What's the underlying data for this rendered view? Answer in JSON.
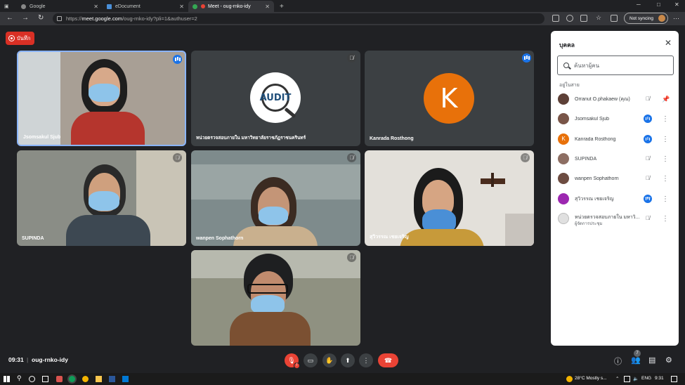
{
  "browser": {
    "tabs": [
      {
        "label": "Google",
        "favicon": "google-icon",
        "active": false
      },
      {
        "label": "eDocument",
        "favicon": "document-icon",
        "active": false
      },
      {
        "label": "Meet - oug-rnko-idy",
        "favicon": "meet-icon",
        "active": true
      }
    ],
    "new_tab": "+",
    "window_controls": {
      "minimize": "─",
      "maximize": "□",
      "close": "✕"
    },
    "url_prefix": "https://",
    "url_domain": "meet.google.com",
    "url_path": "/oug-rnko-idy?pli=1&authuser=2",
    "sync_label": "Not syncing"
  },
  "meet": {
    "record_label": "บันทึก",
    "tiles": [
      {
        "name": "Jsomsakul Sjub",
        "status": "speaking"
      },
      {
        "name": "หน่วยตรวจสอบภายใน มหาวิทยาลัยราชภัฏราชนครินทร์",
        "status": "muted",
        "logo_text": "AUDIT"
      },
      {
        "name": "Kanrada Rosthong",
        "status": "speaking",
        "avatar_letter": "K"
      },
      {
        "name": "SUPINDA",
        "status": "muted"
      },
      {
        "name": "wanpen Sophathorn",
        "status": "muted"
      },
      {
        "name": "สุวิวรรณ เชยเจริญ",
        "status": "muted"
      },
      {
        "name": "",
        "status": "muted"
      }
    ],
    "time": "09:31",
    "separator": "|",
    "meeting_code": "oug-rnko-idy",
    "participant_count": "7",
    "mic_badge": "!"
  },
  "people_panel": {
    "title": "บุคคล",
    "search_placeholder": "ค้นหาผู้คน",
    "section_label": "อยู่ในสาย",
    "participants": [
      {
        "name": "Orranut O.phakaew (คุณ)",
        "avatar": "photo",
        "mic": "muted",
        "action": "pin-icon"
      },
      {
        "name": "Jsomsakul Sjub",
        "avatar": "photo",
        "mic": "speaking",
        "action": "more-icon"
      },
      {
        "name": "Kanrada Rosthong",
        "avatar": "K",
        "mic": "speaking",
        "action": "more-icon"
      },
      {
        "name": "SUPINDA",
        "avatar": "photo",
        "mic": "muted",
        "action": "more-icon"
      },
      {
        "name": "wanpen Sophathorn",
        "avatar": "photo",
        "mic": "muted",
        "action": "more-icon"
      },
      {
        "name": "สุวิวรรณ เชยเจริญ",
        "avatar": "photo",
        "mic": "speaking-dots",
        "action": "more-icon"
      },
      {
        "name": "หน่วยตรวจสอบภายใน มหาวิ...",
        "subtitle": "ผู้จัดการประชุม",
        "avatar": "logo",
        "mic": "muted",
        "action": "more-icon"
      }
    ]
  },
  "taskbar": {
    "weather": "28°C  Mostly s...",
    "lang": "ENG",
    "clock": "9:31"
  },
  "colors": {
    "background": "#202124",
    "accent_blue": "#1a73e8",
    "record_red": "#d93025",
    "end_call_red": "#ea4335",
    "avatar_orange": "#e8710a"
  }
}
